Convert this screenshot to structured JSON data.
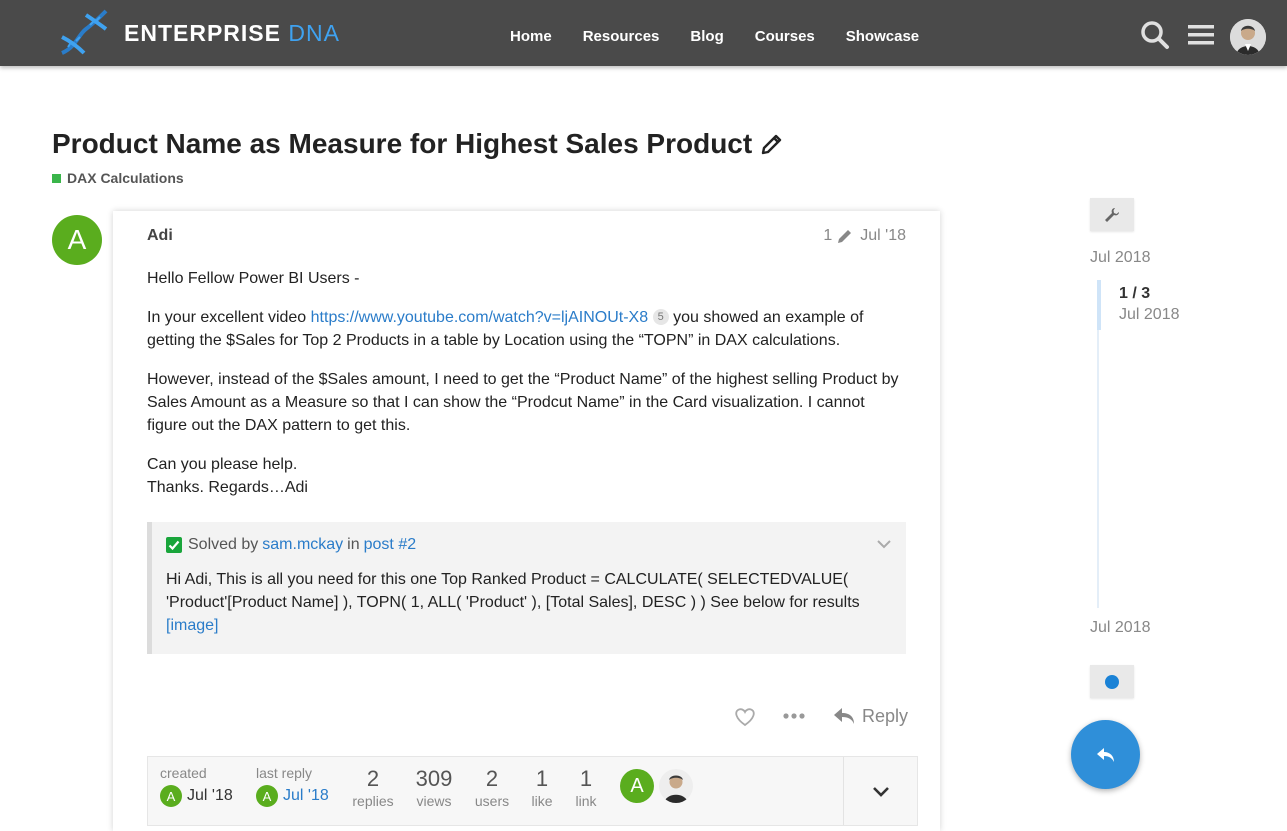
{
  "header": {
    "logo_word1": "ENTERPRISE",
    "logo_word2": "DNA",
    "nav": [
      "Home",
      "Resources",
      "Blog",
      "Courses",
      "Showcase"
    ],
    "icons": [
      "search-icon",
      "hamburger-menu-icon",
      "user-avatar"
    ]
  },
  "topic": {
    "title": "Product Name as Measure for Highest Sales Product",
    "category": "DAX Calculations",
    "category_color": "#3ab54a"
  },
  "post": {
    "avatar_letter": "A",
    "username": "Adi",
    "edit_count": "1",
    "date": "Jul '18",
    "paragraphs": {
      "p1": "Hello Fellow Power BI Users -",
      "p2_before": "In your excellent video ",
      "p2_link": "https://www.youtube.com/watch?v=ljAINOUt-X8",
      "p2_badge": "5",
      "p2_after": " you showed an example of getting the $Sales for Top 2 Products in a table by Location using the “TOPN” in DAX calculations.",
      "p3": "However, instead of the $Sales amount, I need to get the “Product Name” of the highest selling Product by Sales Amount as a Measure so that I can show the “Prodcut Name” in the Card visualization. I cannot figure out the DAX pattern to get this.",
      "p4_line1": "Can you please help.",
      "p4_line2": "Thanks. Regards…Adi"
    },
    "solved": {
      "prefix": "Solved by",
      "user": "sam.mckay",
      "in": "in",
      "post_link": "post #2",
      "text": "Hi Adi, This is all you need for this one Top Ranked Product = CALCULATE( SELECTEDVALUE( 'Product'[Product Name] ), TOPN( 1, ALL( 'Product' ), [Total Sales], DESC ) ) See below for results",
      "image_link": "[image]"
    },
    "reply_label": "Reply"
  },
  "topic_map": {
    "created_label": "created",
    "created_date": "Jul '18",
    "last_reply_label": "last reply",
    "last_reply_date": "Jul '18",
    "stats": [
      {
        "num": "2",
        "label": "replies"
      },
      {
        "num": "309",
        "label": "views"
      },
      {
        "num": "2",
        "label": "users"
      },
      {
        "num": "1",
        "label": "like"
      },
      {
        "num": "1",
        "label": "link"
      }
    ],
    "avatar_letter": "A"
  },
  "timeline": {
    "start_date": "Jul 2018",
    "position": "1 / 3",
    "position_date": "Jul 2018",
    "end_date": "Jul 2018"
  },
  "colors": {
    "header_bg": "#4a4a4a",
    "accent_blue": "#2f8fd9",
    "avatar_green": "#5aad1e",
    "solved_green": "#19a53b",
    "link": "#2a7cc9"
  }
}
